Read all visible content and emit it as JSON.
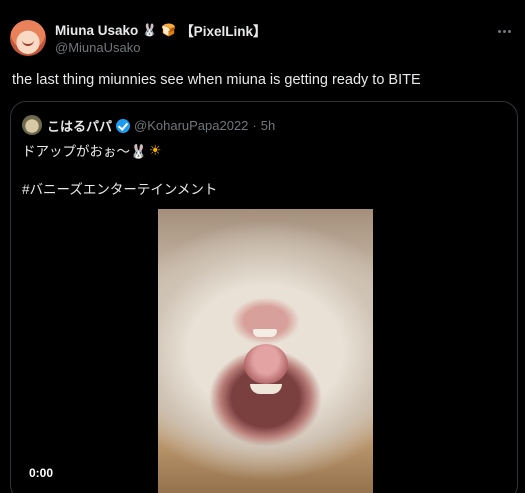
{
  "tweet": {
    "author": {
      "display_name": "Miuna Usako",
      "emoji_1": "🐰",
      "emoji_2": "🍞",
      "tag": "【PixelLink】",
      "handle": "@MiunaUsako"
    },
    "text": "the last thing miunnies see when miuna is getting ready to BITE",
    "more_icon": "more-horizontal-icon"
  },
  "quote": {
    "author": {
      "display_name": "こはるパパ",
      "handle": "@KoharuPapa2022",
      "separator": "·",
      "time": "5h"
    },
    "text_line1": "ドアップがおぉ〜🐰",
    "sun": "☀",
    "hashtag_line": "#バニーズエンターテインメント",
    "video": {
      "timestamp": "0:00"
    }
  },
  "colors": {
    "background": "#000000",
    "text_primary": "#e7e9ea",
    "text_secondary": "#71767b",
    "border": "#2f3336",
    "verified": "#1d9bf0"
  }
}
